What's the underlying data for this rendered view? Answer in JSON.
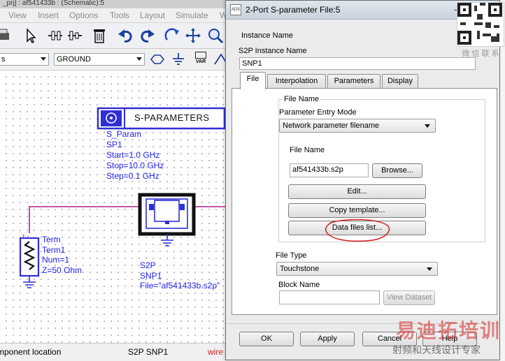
{
  "bg_window": {
    "title": "_prj] : af541433b : (Schematic):5",
    "menu": [
      "View",
      "Insert",
      "Options",
      "Tools",
      "Layout",
      "Simulate",
      "W"
    ],
    "combo_left": "s",
    "combo_ground": "GROUND",
    "var_label": "VAR",
    "status": {
      "left": "mponent location",
      "mid": "S2P SNP1",
      "right": "wire"
    }
  },
  "schematic": {
    "sparams_title": "S-PARAMETERS",
    "sparams_lines": [
      "S_Param",
      "SP1",
      "Start=1.0 GHz",
      "Stop=10.0 GHz",
      "Step=0.1 GHz"
    ],
    "term_lines": [
      "Term",
      "Term1",
      "Num=1",
      "Z=50 Ohm"
    ],
    "s2p_lines": [
      "S2P",
      "SNP1",
      "File=\"af541433b.s2p\""
    ],
    "term_pins": "+ -"
  },
  "dialog": {
    "title": "2-Port S-parameter File:5",
    "instance_name_label": "Instance Name",
    "s2p_instance_label": "S2P Instance Name",
    "instance_value": "SNP1",
    "tabs": [
      "File",
      "Interpolation",
      "Parameters",
      "Display"
    ],
    "active_tab": "File",
    "file_name_group": "File Name",
    "param_entry_label": "Parameter Entry Mode",
    "param_entry_value": "Network parameter filename",
    "file_name_label": "File Name",
    "file_name_value": "af541433b.s2p",
    "browse_label": "Browse...",
    "edit_label": "Edit...",
    "copy_template_label": "Copy template...",
    "data_files_label": "Data files list...",
    "file_type_label": "File Type",
    "file_type_value": "Touchstone",
    "block_name_label": "Block Name",
    "block_name_value": "",
    "view_dataset_label": "View Dataset",
    "ok_label": "OK",
    "apply_label": "Apply",
    "cancel_label": "Cancel",
    "help_label": "Help",
    "annotation_color": "#d42020"
  },
  "watermarks": {
    "qr_caption": "微 信 联 系",
    "brand_top": "易迪拓培训",
    "brand_bottom": "射频和天线设计专家"
  },
  "colors": {
    "wire": "#b0208a",
    "component": "#2f2fd6",
    "schematic_text": "#2222ee"
  }
}
